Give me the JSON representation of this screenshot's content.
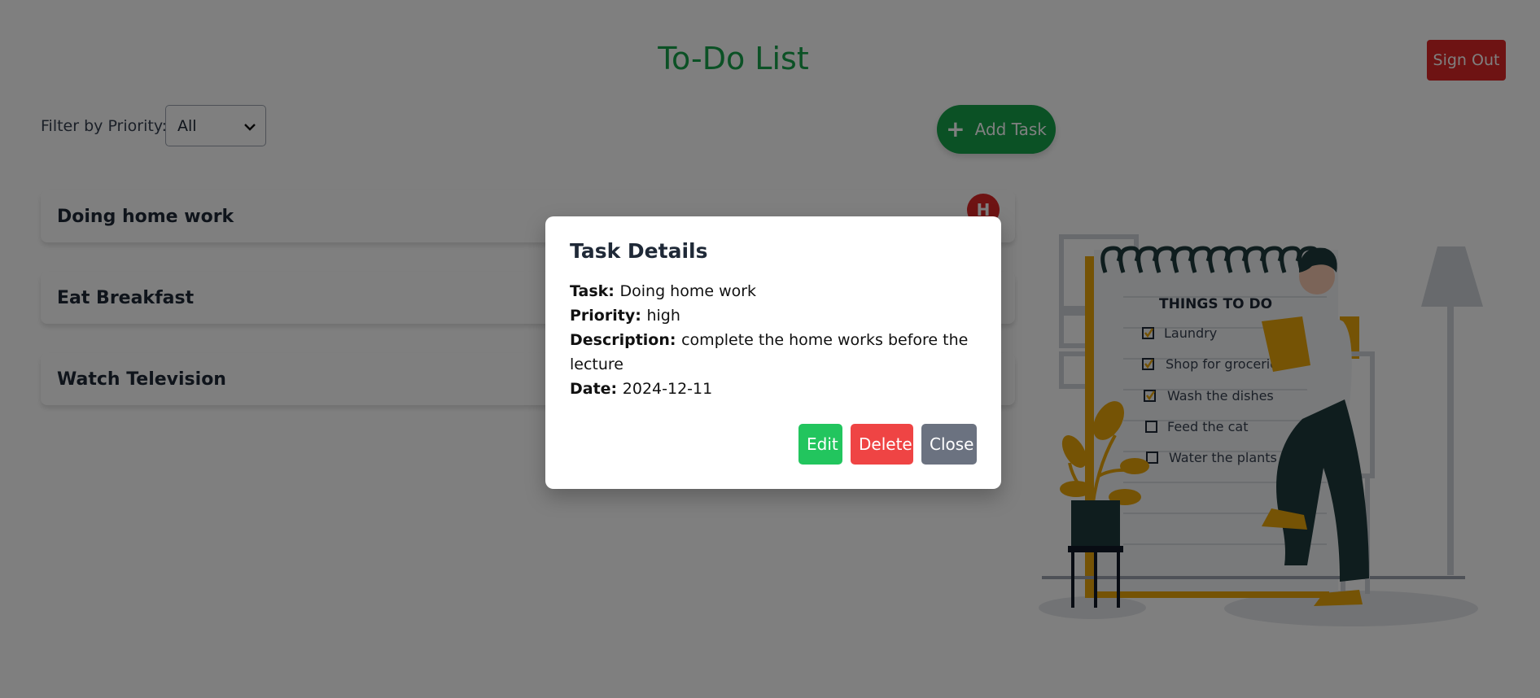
{
  "header": {
    "title": "To-Do List",
    "sign_out_label": "Sign Out"
  },
  "filter": {
    "label": "Filter by Priority:",
    "selected": "All"
  },
  "add_task": {
    "label": "Add Task",
    "icon": "plus-icon"
  },
  "tasks": [
    {
      "title": "Doing home work",
      "priority_badge": "H"
    },
    {
      "title": "Eat Breakfast"
    },
    {
      "title": "Watch Television"
    }
  ],
  "illustration": {
    "heading": "THINGS TO DO",
    "items": [
      {
        "label": "Laundry",
        "checked": true
      },
      {
        "label": "Shop for groceries",
        "checked": true
      },
      {
        "label": "Wash the dishes",
        "checked": true
      },
      {
        "label": "Feed the cat",
        "checked": false
      },
      {
        "label": "Water the plants",
        "checked": false
      }
    ]
  },
  "modal": {
    "title": "Task Details",
    "task_label": "Task:",
    "task_value": "Doing home work",
    "priority_label": "Priority:",
    "priority_value": "high",
    "description_label": "Description:",
    "description_value": "complete the home works before the lecture",
    "date_label": "Date:",
    "date_value": "2024-12-11",
    "edit_label": "Edit",
    "delete_label": "Delete",
    "close_label": "Close"
  },
  "colors": {
    "brand_green": "#16a34a",
    "danger_red": "#dc2626",
    "muted_gray": "#6b7280",
    "overlay": "rgba(0,0,0,0.5)"
  }
}
